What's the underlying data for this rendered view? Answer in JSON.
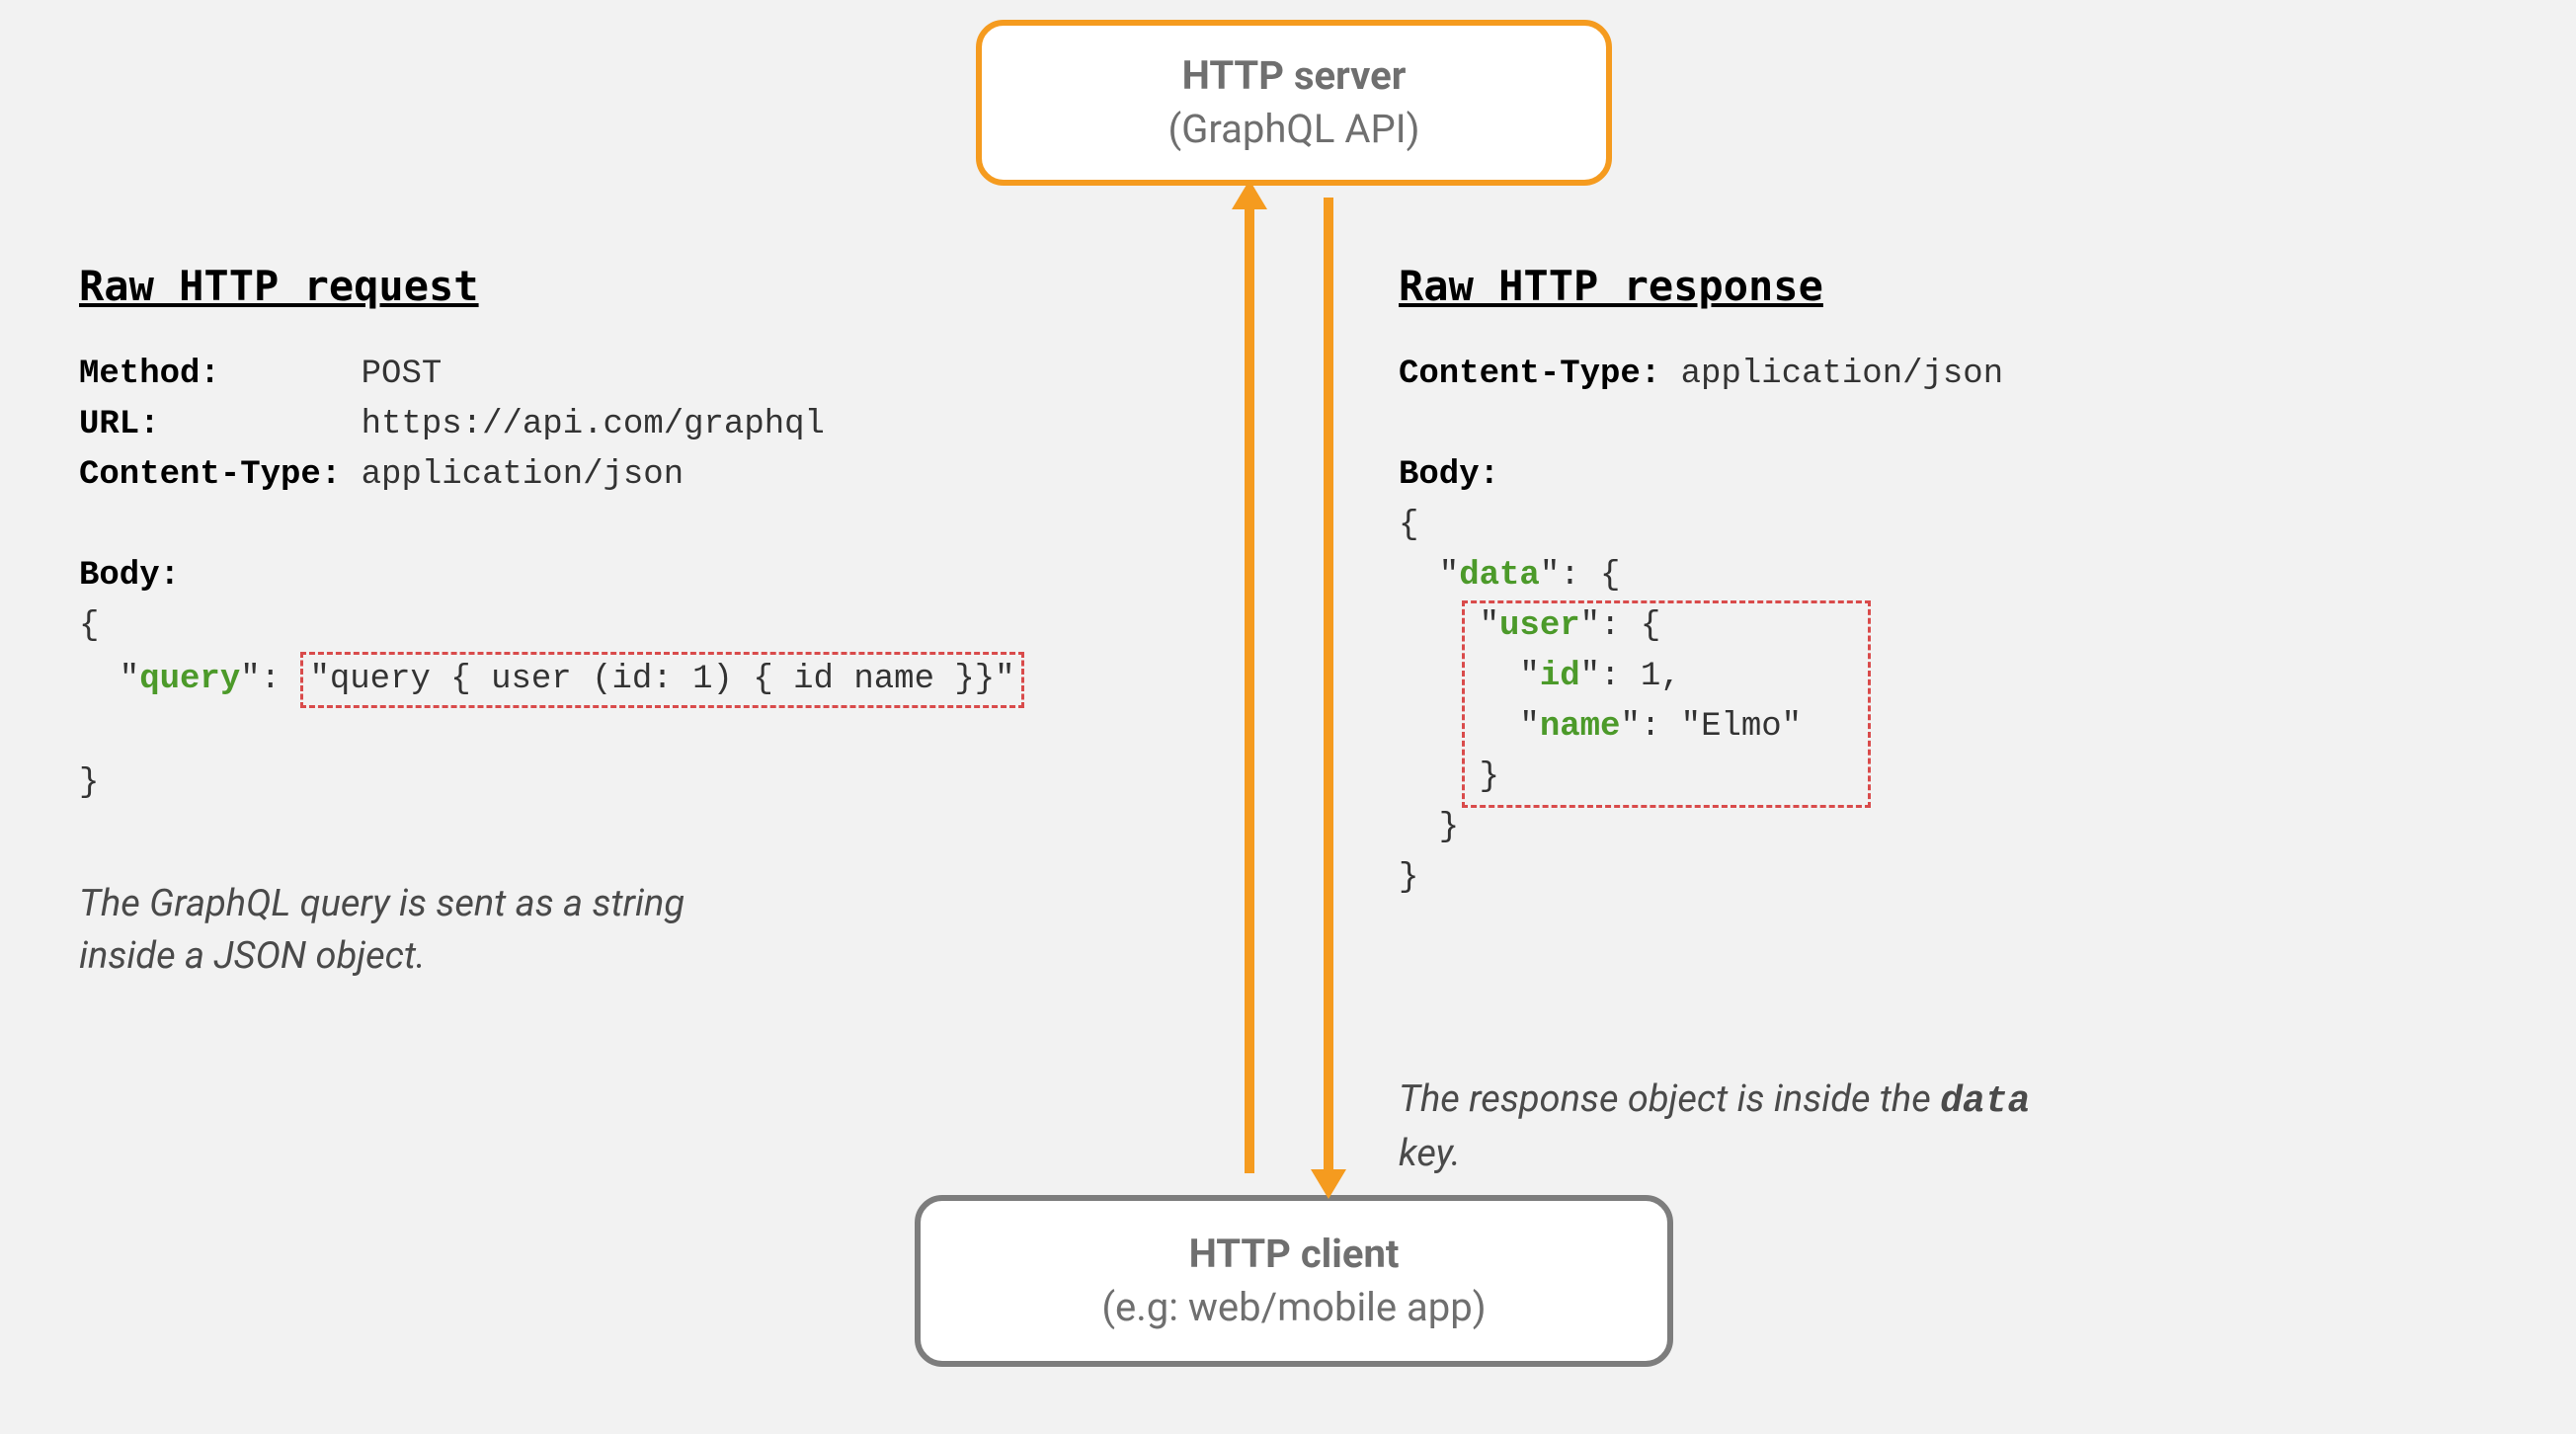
{
  "server": {
    "title": "HTTP server",
    "subtitle": "(GraphQL API)"
  },
  "client": {
    "title": "HTTP client",
    "subtitle": "(e.g: web/mobile app)"
  },
  "request": {
    "heading": "Raw HTTP request",
    "method_label": "Method:",
    "method_value": "POST",
    "url_label": "URL:",
    "url_value": "https://api.com/graphql",
    "ctype_label": "Content-Type:",
    "ctype_value": "application/json",
    "body_label": "Body:",
    "brace_open": "{",
    "q_open": "  \"",
    "query_key": "query",
    "q_mid": "\": ",
    "query_value": "\"query { user (id: 1) { id name }}\"",
    "brace_close": "}",
    "caption": "The GraphQL query is sent as a string\ninside a JSON object."
  },
  "response": {
    "heading": "Raw HTTP response",
    "ctype_label": "Content-Type:",
    "ctype_value": "application/json",
    "body_label": "Body:",
    "l1": "{",
    "l2a": "  \"",
    "l2key": "data",
    "l2b": "\": {",
    "l3a": "    \"",
    "l3key": "user",
    "l3b": "\": {",
    "l4a": "      \"",
    "l4key": "id",
    "l4b": "\": 1,",
    "l5a": "      \"",
    "l5key": "name",
    "l5b": "\": \"Elmo\"",
    "l6": "    }",
    "l7": "  }",
    "l8": "}",
    "caption_pre": "The response object is inside the ",
    "caption_code": "data",
    "caption_post": "\nkey."
  }
}
